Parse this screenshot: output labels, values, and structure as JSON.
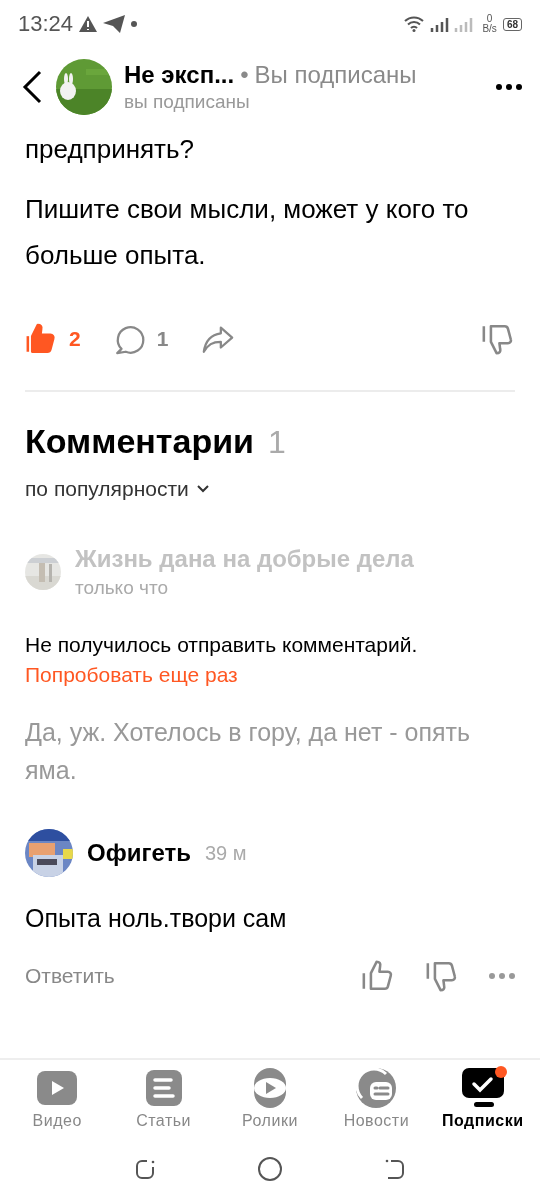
{
  "status_bar": {
    "time": "13:24",
    "net_speed_value": "0",
    "net_speed_unit": "B/s",
    "battery": "68"
  },
  "header": {
    "channel": "Не эксп...",
    "separator": "•",
    "subscribed_label": "Вы подписаны",
    "subtitle": "вы подписаны"
  },
  "article": {
    "cut_line": "предпринять?",
    "paragraph": "Пишите свои мысли, может у кого то больше опыта."
  },
  "actions": {
    "liked": true,
    "likes": "2",
    "comments": "1"
  },
  "comments_section": {
    "title": "Комментарии",
    "count": "1",
    "sort": "по популярности"
  },
  "comments": [
    {
      "kind": "failed",
      "author": "Жизнь дана на добрые дела",
      "time": "только что",
      "error": "Не получилось отправить комментарий.",
      "retry": "Попробовать еще раз",
      "text": "Да, уж. Хотелось в гору, да нет - опять яма."
    },
    {
      "kind": "normal",
      "author": "Офигеть",
      "time": "39 м",
      "text": "Опыта ноль.твори сам",
      "reply": "Ответить"
    }
  ],
  "bottom_nav": [
    {
      "label": "Видео",
      "kind": "video",
      "selected": false,
      "badge": false
    },
    {
      "label": "Статьи",
      "kind": "articles",
      "selected": false,
      "badge": false
    },
    {
      "label": "Ролики",
      "kind": "clips",
      "selected": false,
      "badge": false
    },
    {
      "label": "Новости",
      "kind": "news",
      "selected": false,
      "badge": false
    },
    {
      "label": "Подписки",
      "kind": "subs",
      "selected": true,
      "badge": true
    }
  ]
}
